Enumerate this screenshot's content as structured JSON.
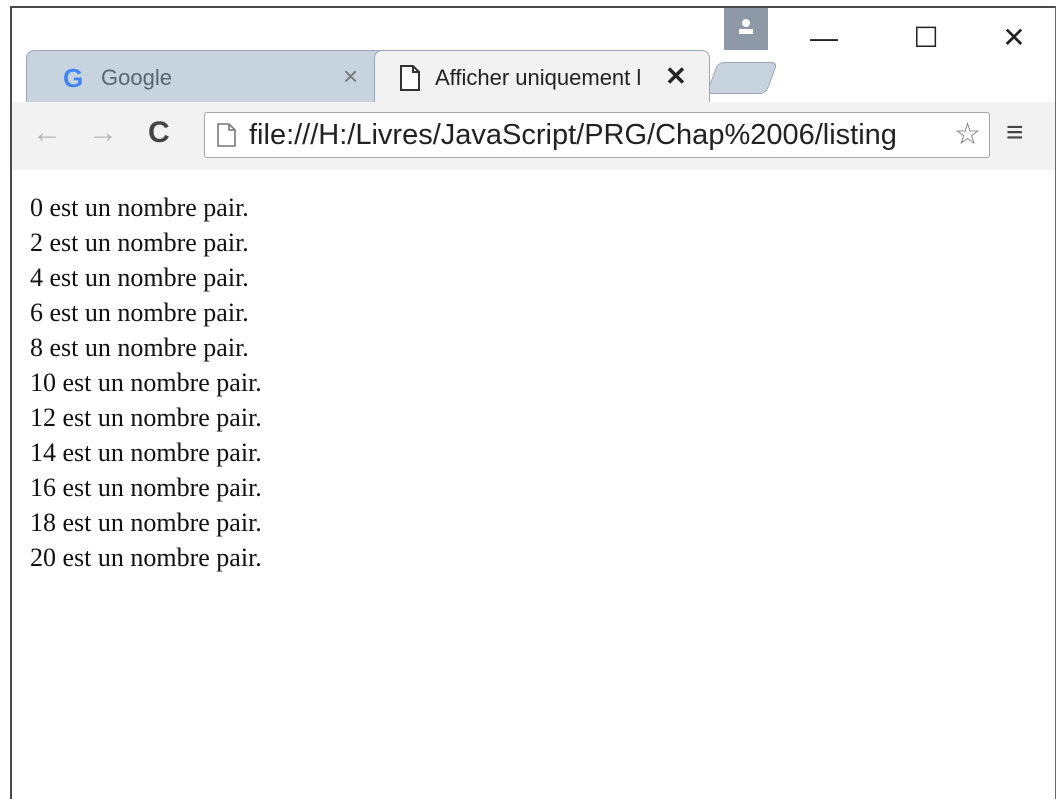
{
  "tabs": [
    {
      "title": "Google",
      "logo": "G",
      "close": "×",
      "icon": "google-logo"
    },
    {
      "title": "Afficher uniquement l",
      "close": "✕",
      "icon": "document-icon"
    }
  ],
  "window_controls": {
    "minimize": "—",
    "maximize": "☐",
    "close": "✕"
  },
  "toolbar": {
    "back": "←",
    "forward": "→",
    "reload": "C",
    "url": "file:///H:/Livres/JavaScript/PRG/Chap%2006/listing",
    "star": "☆",
    "menu": "≡"
  },
  "content": {
    "lines": [
      "0 est un nombre pair.",
      "2 est un nombre pair.",
      "4 est un nombre pair.",
      "6 est un nombre pair.",
      "8 est un nombre pair.",
      "10 est un nombre pair.",
      "12 est un nombre pair.",
      "14 est un nombre pair.",
      "16 est un nombre pair.",
      "18 est un nombre pair.",
      "20 est un nombre pair."
    ]
  }
}
